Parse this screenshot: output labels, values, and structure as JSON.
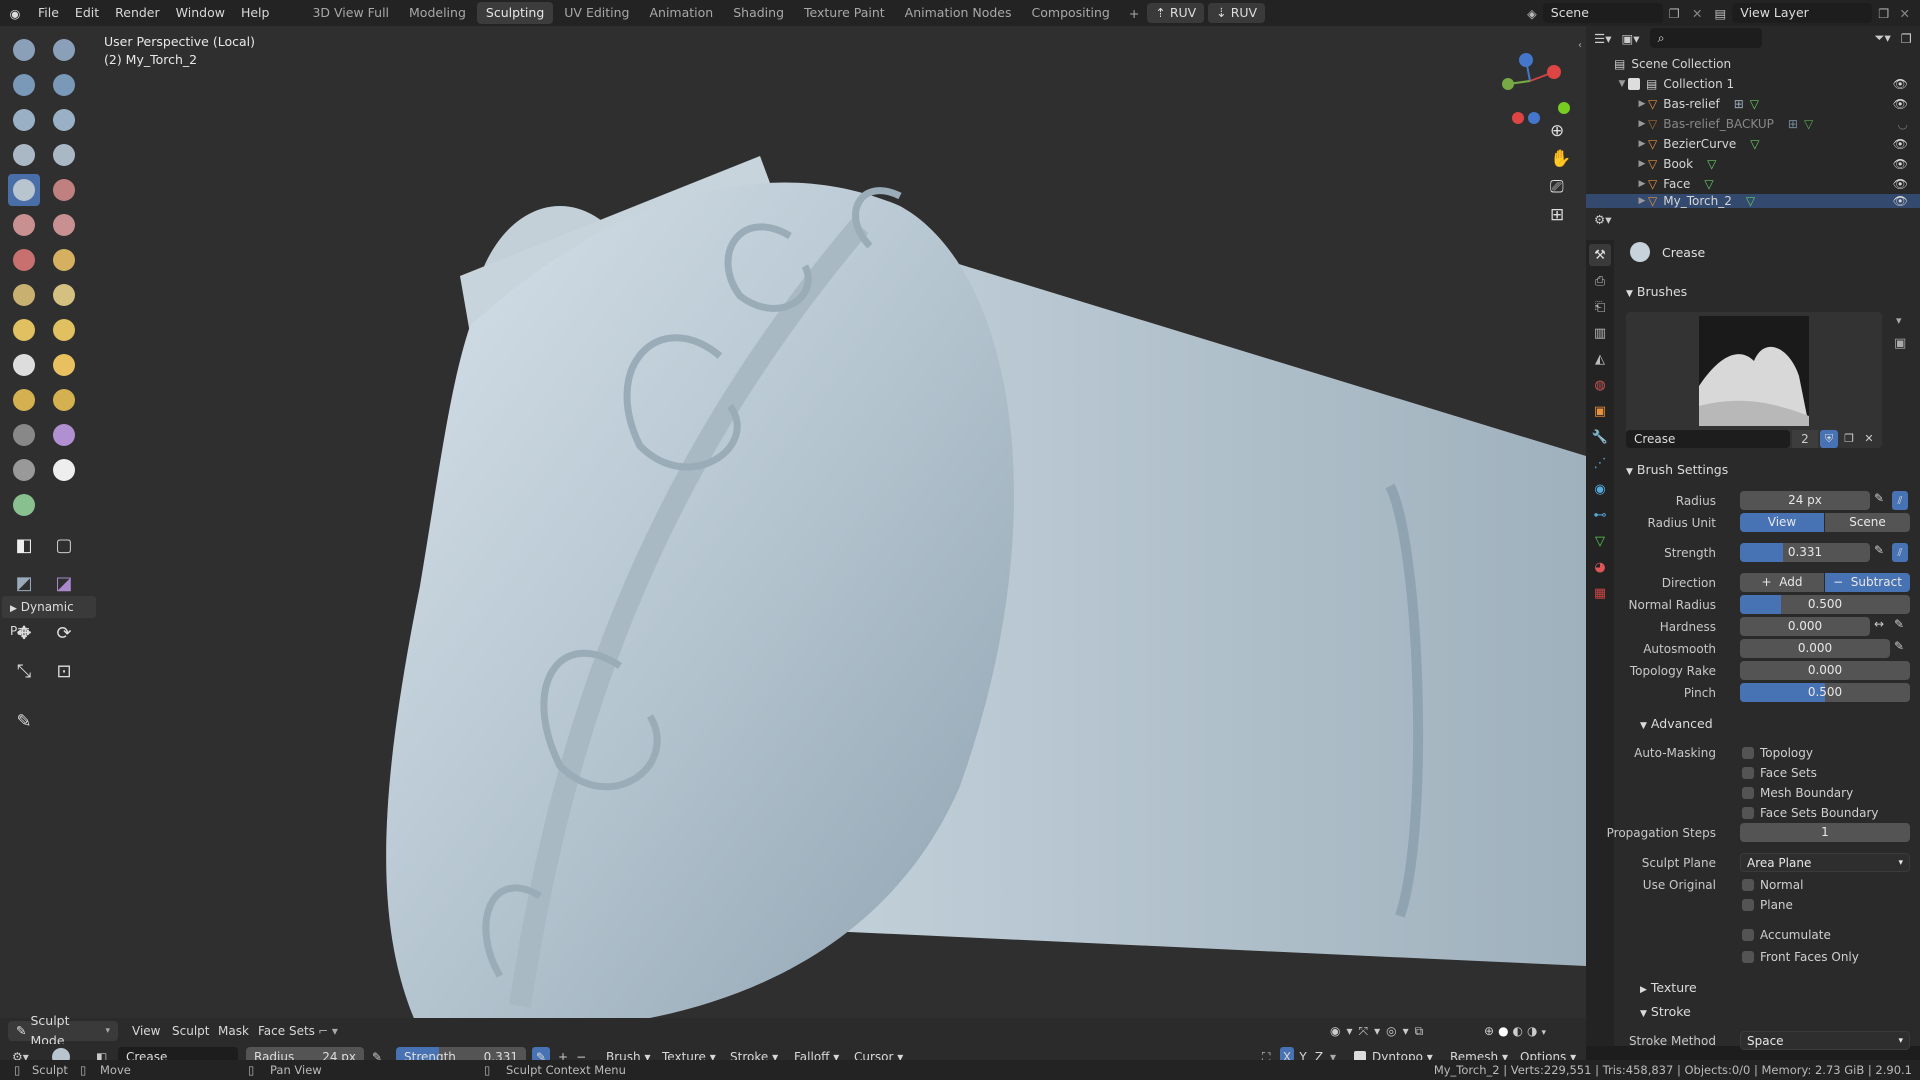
{
  "menu": [
    "File",
    "Edit",
    "Render",
    "Window",
    "Help"
  ],
  "workspaces": [
    "3D View Full",
    "Modeling",
    "Sculpting",
    "UV Editing",
    "Animation",
    "Shading",
    "Texture Paint",
    "Animation Nodes",
    "Compositing"
  ],
  "active_workspace": "Sculpting",
  "ruv_buttons": [
    "RUV",
    "RUV"
  ],
  "scene_name": "Scene",
  "view_layer": "View Layer",
  "viewport": {
    "title": "User Perspective (Local)",
    "subtitle": "(2) My_Torch_2",
    "dynamic_panel": "Dynamic Par"
  },
  "outliner": {
    "scene_collection": "Scene Collection",
    "collection": "Collection 1",
    "items": [
      "Bas-relief",
      "Bas-relief_BACKUP",
      "BezierCurve",
      "Book",
      "Face",
      "My_Torch_2"
    ]
  },
  "properties": {
    "tool_name": "Crease",
    "brushes_header": "Brushes",
    "brush_name": "Crease",
    "brush_users": "2",
    "brush_settings_header": "Brush Settings",
    "radius_label": "Radius",
    "radius_value": "24 px",
    "radius_unit_label": "Radius Unit",
    "radius_unit_view": "View",
    "radius_unit_scene": "Scene",
    "strength_label": "Strength",
    "strength_value": "0.331",
    "strength_fraction": 0.331,
    "direction_label": "Direction",
    "direction_add": "Add",
    "direction_subtract": "Subtract",
    "normal_radius_label": "Normal Radius",
    "normal_radius_value": "0.500",
    "hardness_label": "Hardness",
    "hardness_value": "0.000",
    "autosmooth_label": "Autosmooth",
    "autosmooth_value": "0.000",
    "topology_rake_label": "Topology Rake",
    "topology_rake_value": "0.000",
    "pinch_label": "Pinch",
    "pinch_value": "0.500",
    "advanced_header": "Advanced",
    "automasking_label": "Auto-Masking",
    "automasking_options": [
      "Topology",
      "Face Sets",
      "Mesh Boundary",
      "Face Sets Boundary"
    ],
    "propagation_label": "Propagation Steps",
    "propagation_value": "1",
    "sculpt_plane_label": "Sculpt Plane",
    "sculpt_plane_value": "Area Plane",
    "use_original_label": "Use Original",
    "use_original_options": [
      "Normal",
      "Plane"
    ],
    "accumulate": "Accumulate",
    "front_faces_only": "Front Faces Only",
    "texture_header": "Texture",
    "stroke_header": "Stroke",
    "stroke_method_label": "Stroke Method",
    "stroke_method_value": "Space"
  },
  "viewport_header": {
    "mode": "Sculpt Mode",
    "menus": [
      "View",
      "Sculpt",
      "Mask",
      "Face Sets"
    ],
    "dyntopo": "Dyntopo",
    "remesh": "Remesh",
    "options": "Options",
    "axes": [
      "X",
      "Y",
      "Z"
    ]
  },
  "tool_header": {
    "brush": "Crease",
    "radius_label": "Radius",
    "radius_value": "24 px",
    "strength_label": "Strength",
    "strength_value": "0.331",
    "menus": [
      "Brush",
      "Texture",
      "Stroke",
      "Falloff",
      "Cursor"
    ]
  },
  "status": {
    "left": [
      "Sculpt",
      "Move",
      "Pan View",
      "Sculpt Context Menu"
    ],
    "right": "My_Torch_2 | Verts:229,551 | Tris:458,837 | Objects:0/0 | Memory: 2.73 GiB | 2.90.1"
  },
  "colors": {
    "accent": "#4772b3",
    "selection": "#33496e",
    "mesh": "#b9c8d2"
  }
}
